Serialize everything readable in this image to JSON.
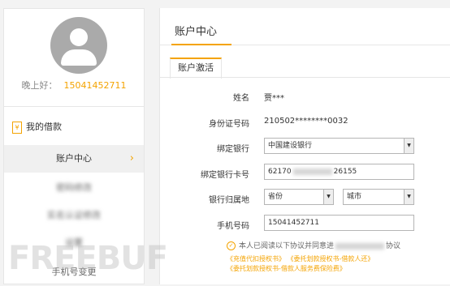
{
  "sidebar": {
    "greeting": "晚上好：",
    "username": "15041452711",
    "section_title": "我的借款",
    "section_icon": "wallet-icon",
    "active_item": "账户中心",
    "items_blurred": [
      "密码修改",
      "实名认证修改",
      "设置",
      "手机号变更"
    ],
    "last_item": "手机号变更"
  },
  "main": {
    "title": "账户中心",
    "tab": "账户激活",
    "fields": {
      "name_label": "姓名",
      "name_value": "贾***",
      "id_label": "身份证号码",
      "id_value": "210502********0032",
      "bank_label": "绑定银行",
      "bank_value": "中国建设银行",
      "card_label": "绑定银行卡号",
      "card_prefix": "62170",
      "card_suffix": "26155",
      "region_label": "银行归属地",
      "province_value": "省份",
      "city_value": "城市",
      "phone_label": "手机号码",
      "phone_value": "15041452711"
    },
    "agreement_prefix": "本人已阅读以下协议并同意进",
    "agreement_suffix": "协议",
    "link1": "《充值代扣授权书》",
    "link2": "《委托划款授权书-借款人还》",
    "link3": "《委托划款授权书-借款人服务费保险费》"
  },
  "watermark": "FREEBUF",
  "colors": {
    "accent": "#f4a300",
    "avatar": "#aaaaaa",
    "border": "#b5b5b5"
  }
}
